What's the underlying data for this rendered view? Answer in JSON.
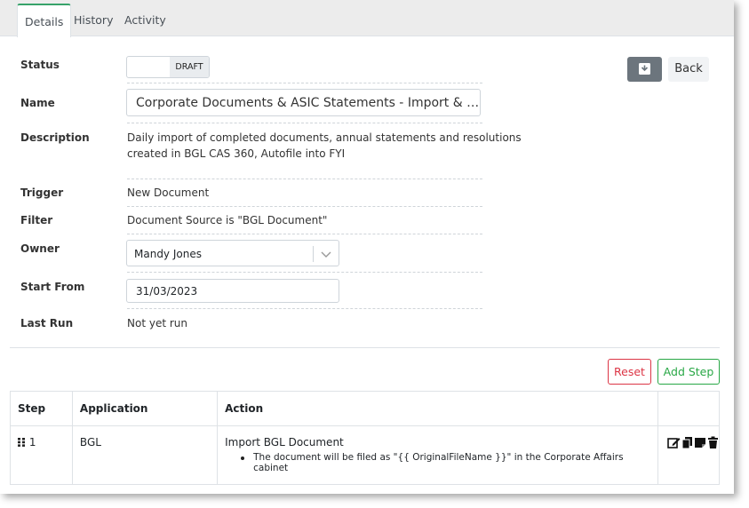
{
  "tabs": [
    {
      "label": "Details"
    },
    {
      "label": "History"
    },
    {
      "label": "Activity"
    }
  ],
  "form": {
    "status_label": "Status",
    "status_value": "DRAFT",
    "name_label": "Name",
    "name_value": "Corporate Documents & ASIC Statements - Import & Autofile",
    "description_label": "Description",
    "description_line1": "Daily import of completed documents, annual statements and resolutions",
    "description_line2": "created in BGL CAS 360, Autofile into FYI",
    "trigger_label": "Trigger",
    "trigger_value": "New Document",
    "filter_label": "Filter",
    "filter_value": "Document Source is \"BGL Document\"",
    "owner_label": "Owner",
    "owner_value": "Mandy Jones",
    "start_label": "Start From",
    "start_value": "31/03/2023",
    "lastrun_label": "Last Run",
    "lastrun_value": "Not yet run"
  },
  "actions": {
    "back_label": "Back",
    "reset_label": "Reset",
    "add_step_label": "Add Step"
  },
  "table": {
    "headers": [
      "Step",
      "Application",
      "Action",
      ""
    ],
    "rows": [
      {
        "step": "1",
        "application": "BGL",
        "action_title": "Import BGL Document",
        "action_detail": "The document will be filed as \"{{ OriginalFileName }}\" in the Corporate Affairs cabinet"
      }
    ]
  },
  "colors": {
    "tab_accent": "#37a36a",
    "reset": "#dc3545",
    "add": "#28a745",
    "icon_button": "#6c757d"
  }
}
